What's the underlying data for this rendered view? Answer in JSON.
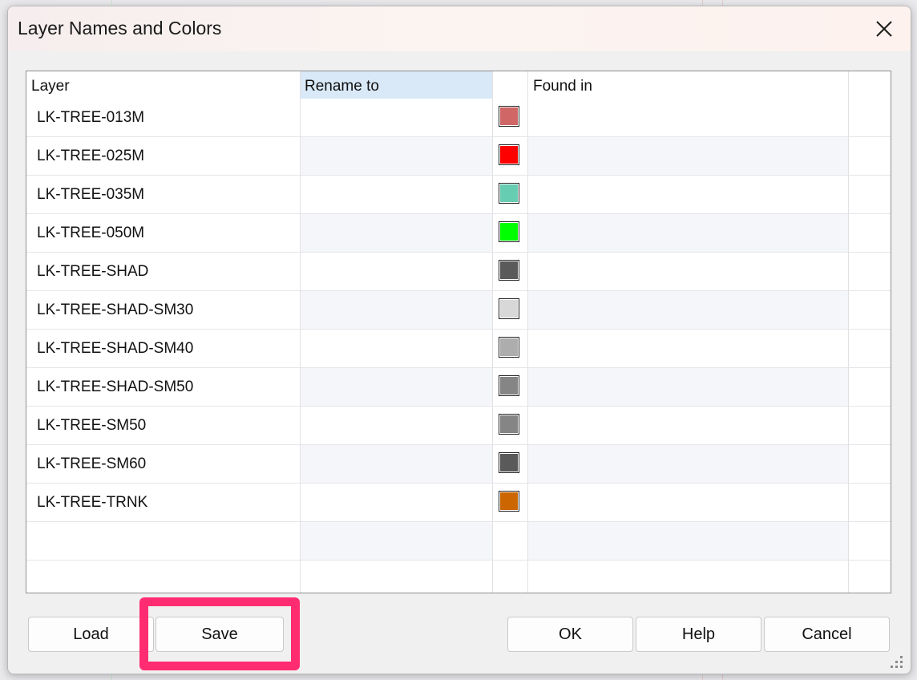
{
  "window": {
    "title": "Layer Names and Colors"
  },
  "grid": {
    "columns": {
      "layer": "Layer",
      "rename": "Rename to",
      "color": "",
      "found": "Found in"
    },
    "rows": [
      {
        "layer": "LK-TREE-013M",
        "rename": "",
        "color": "#d06666",
        "found": ""
      },
      {
        "layer": "LK-TREE-025M",
        "rename": "",
        "color": "#ff0000",
        "found": ""
      },
      {
        "layer": "LK-TREE-035M",
        "rename": "",
        "color": "#66ccb2",
        "found": ""
      },
      {
        "layer": "LK-TREE-050M",
        "rename": "",
        "color": "#00ff00",
        "found": ""
      },
      {
        "layer": "LK-TREE-SHAD",
        "rename": "",
        "color": "#5a5a5a",
        "found": ""
      },
      {
        "layer": "LK-TREE-SHAD-SM30",
        "rename": "",
        "color": "#d8d8d8",
        "found": ""
      },
      {
        "layer": "LK-TREE-SHAD-SM40",
        "rename": "",
        "color": "#adadad",
        "found": ""
      },
      {
        "layer": "LK-TREE-SHAD-SM50",
        "rename": "",
        "color": "#858585",
        "found": ""
      },
      {
        "layer": "LK-TREE-SM50",
        "rename": "",
        "color": "#858585",
        "found": ""
      },
      {
        "layer": "LK-TREE-SM60",
        "rename": "",
        "color": "#5a5a5a",
        "found": ""
      },
      {
        "layer": "LK-TREE-TRNK",
        "rename": "",
        "color": "#cc6600",
        "found": ""
      }
    ]
  },
  "buttons": {
    "load": "Load",
    "save": "Save",
    "ok": "OK",
    "help": "Help",
    "cancel": "Cancel"
  },
  "accent": {
    "highlight": "#ff2c72"
  },
  "icons": {
    "close": "close-icon",
    "resize": "resize-grip-icon"
  }
}
